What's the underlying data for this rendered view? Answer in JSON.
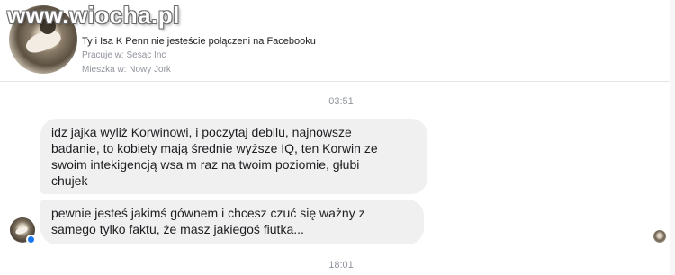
{
  "watermark": {
    "text": "www.wiocha.pl"
  },
  "header": {
    "connection_text": "Ty i Isa K Penn nie jesteście połączeni na Facebooku",
    "work_text": "Pracuje w: Sesac Inc",
    "lives_text": "Mieszka w: Nowy Jork"
  },
  "messages": {
    "timestamp_1": "03:51",
    "bubble_1_lines": [
      "idz jajka wyliż Korwinowi, i poczytaj debilu, najnowsze",
      "badanie, to kobiety mają średnie wyższe IQ, ten Korwin ze",
      "swoim intekigencją wsa m raz na twoim poziomie, głubi",
      "chujek"
    ],
    "bubble_2_lines": [
      "pewnie jesteś jakimś gównem i chcesz czuć się ważny z",
      "samego tylko faktu, że masz jakiegoś fiutka..."
    ],
    "timestamp_2": "18:01"
  },
  "colors": {
    "bubble_bg": "#f1f0f0",
    "meta_gray": "#90949c",
    "active_blue": "#1877f2"
  }
}
